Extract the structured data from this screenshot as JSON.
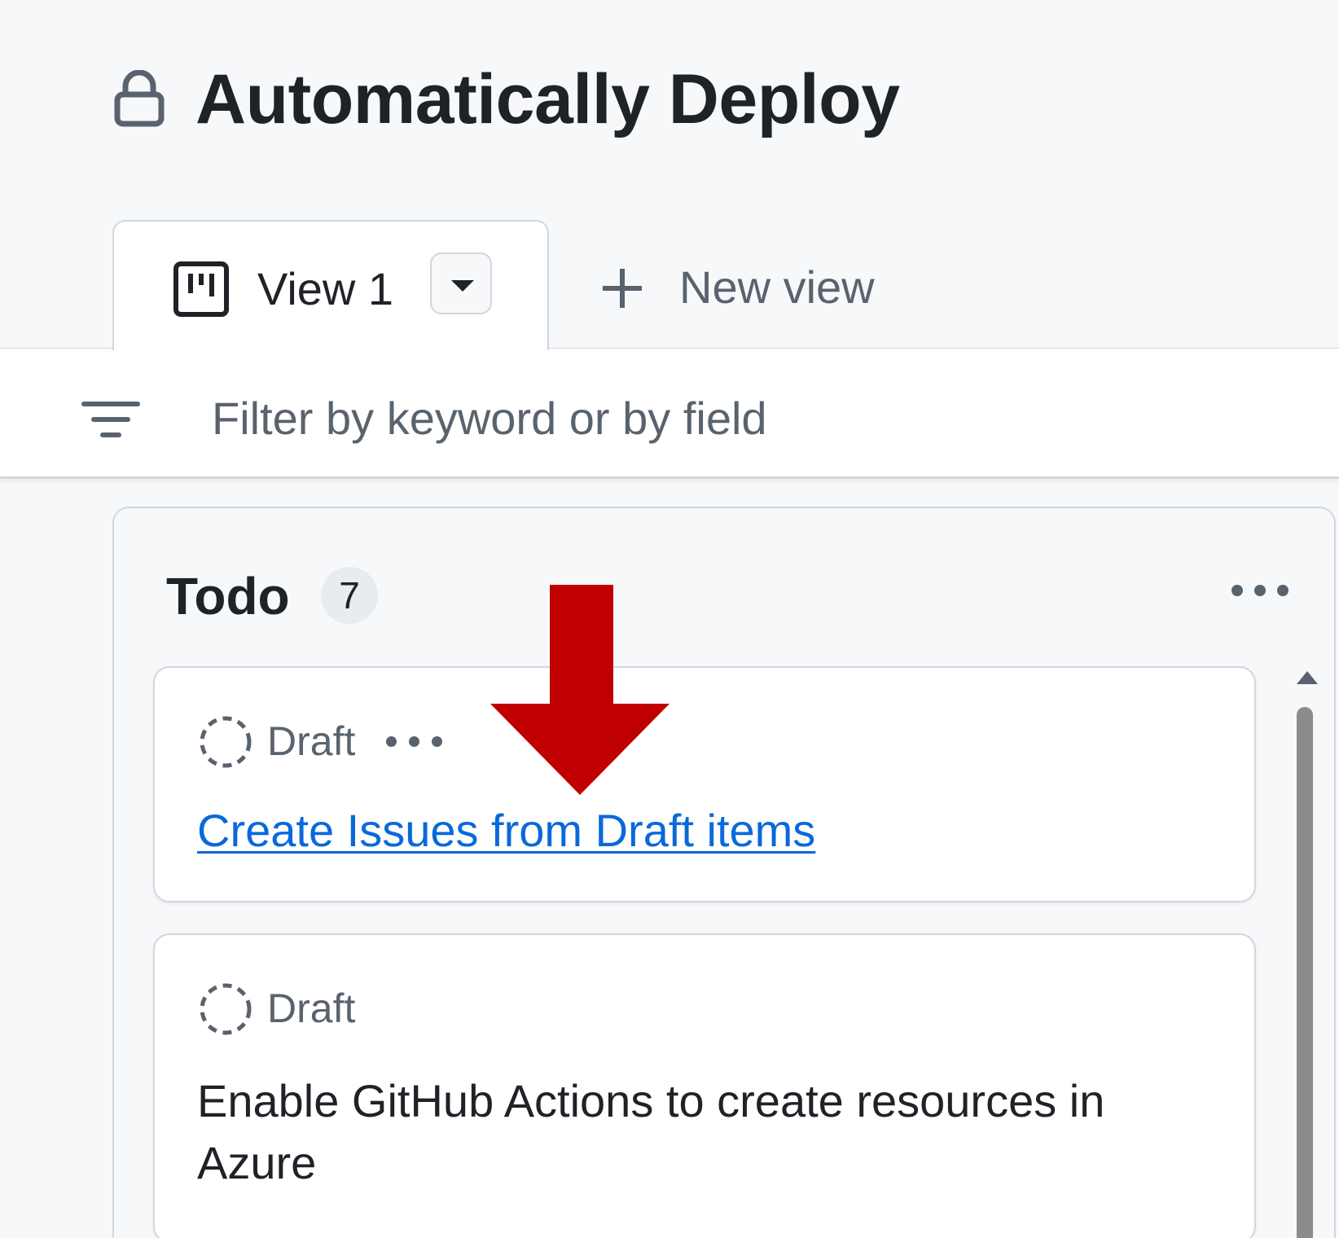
{
  "header": {
    "title": "Automatically Deploy",
    "lock_icon": "lock-icon"
  },
  "tabs": {
    "active": {
      "label": "View 1",
      "icon": "project-board-icon"
    },
    "new_view_label": "New view"
  },
  "filter": {
    "placeholder": "Filter by keyword or by field",
    "value": ""
  },
  "column": {
    "title": "Todo",
    "count": "7",
    "cards": [
      {
        "type_label": "Draft",
        "title": "Create Issues from Draft items",
        "is_link": true
      },
      {
        "type_label": "Draft",
        "title": "Enable GitHub Actions to create resources in Azure",
        "is_link": false
      }
    ]
  },
  "colors": {
    "link": "#0969da",
    "muted_text": "#59636e",
    "annotation_arrow": "#c00000",
    "border": "#d0d7de"
  }
}
